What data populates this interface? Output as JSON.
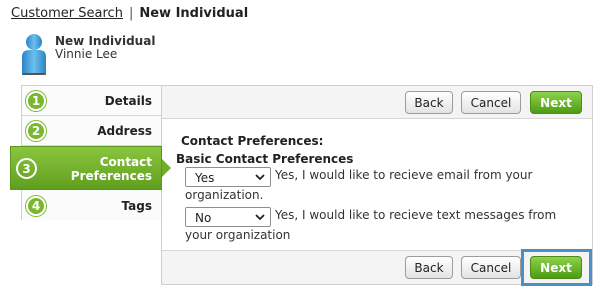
{
  "breadcrumb": {
    "link": "Customer Search",
    "separator": "|",
    "current": "New Individual"
  },
  "header": {
    "name": "New Individual",
    "subtitle": "Vinnie Lee",
    "avatar_icon": "person-icon"
  },
  "steps": [
    {
      "num": "1",
      "label": "Details"
    },
    {
      "num": "2",
      "label": "Address"
    },
    {
      "num": "3",
      "label_line1": "Contact",
      "label_line2": "Preferences",
      "active": true
    },
    {
      "num": "4",
      "label": "Tags"
    }
  ],
  "buttons": {
    "back": "Back",
    "cancel": "Cancel",
    "next": "Next"
  },
  "form": {
    "section_title": "Contact Preferences:",
    "sub_title": "Basic Contact Preferences",
    "email_pref": {
      "value": "Yes",
      "text": "Yes, I would like to recieve email from your organization."
    },
    "sms_pref": {
      "value": "No",
      "text": "Yes, I would like to recieve text messages from your organization"
    }
  },
  "colors": {
    "accent_green": "#6fad2a",
    "highlight_blue": "#4a90c6"
  }
}
